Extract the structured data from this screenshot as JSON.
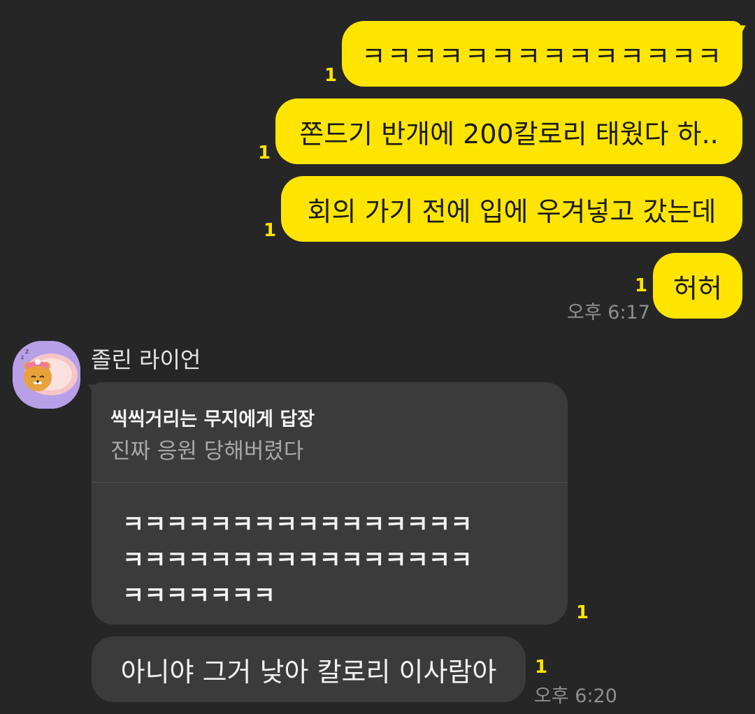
{
  "sent_messages": [
    {
      "text": "ㅋㅋㅋㅋㅋㅋㅋㅋㅋㅋㅋㅋㅋㅋ",
      "unread": "1"
    },
    {
      "text": "쫀드기 반개에 200칼로리 태웠다 하..",
      "unread": "1"
    },
    {
      "text": "회의 가기 전에 입에 우겨넣고 갔는데",
      "unread": "1"
    },
    {
      "text": "허허",
      "unread": "1"
    }
  ],
  "sent_time": "오후 6:17",
  "received": {
    "sender_name": "졸린 라이언",
    "reply": {
      "title": "씩씩거리는 무지에게 답장",
      "quoted": "진짜 응원 당해버렸다"
    },
    "laugh_lines": [
      "ㅋㅋㅋㅋㅋㅋㅋㅋㅋㅋㅋㅋㅋㅋㅋㅋ",
      "ㅋㅋㅋㅋㅋㅋㅋㅋㅋㅋㅋㅋㅋㅋㅋㅋ",
      "ㅋㅋㅋㅋㅋㅋㅋ"
    ],
    "reply_unread": "1",
    "second_message": "아니야 그거 낮아 칼로리 이사람아",
    "second_unread": "1",
    "time": "오후 6:20"
  },
  "colors": {
    "background": "#262626",
    "my_bubble": "#fee500",
    "their_bubble": "#3b3b3b",
    "unread": "#fee500"
  },
  "icons": {
    "avatar": "ryan-sleeping-avatar"
  }
}
